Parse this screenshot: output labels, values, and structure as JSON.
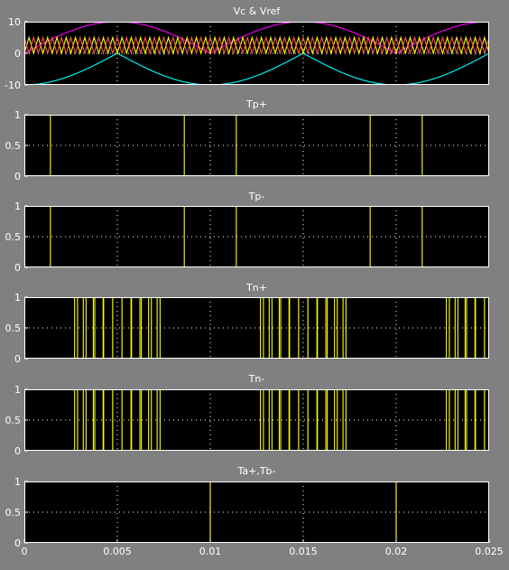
{
  "window": {
    "background": "#808080"
  },
  "colors": {
    "axes_bg": "#000000",
    "axes_border": "#ffffff",
    "grid": "#ffffff",
    "text": "#ffffff",
    "yellow": "#ffff00",
    "magenta": "#ff00ff",
    "cyan": "#00ffff",
    "red": "#ff5050"
  },
  "chart_data": [
    {
      "type": "line",
      "title": "Vc & Vref",
      "xlim": [
        0,
        0.025
      ],
      "ylim": [
        -10,
        10
      ],
      "yticks": [
        -10,
        0,
        10
      ],
      "grid": true,
      "series": [
        {
          "color": "#ff00ff",
          "kind": "abs_sine",
          "amplitude": 10,
          "frequency_hz": 50,
          "phase": 0
        },
        {
          "color": "#00ffff",
          "kind": "abs_sine",
          "amplitude": 10,
          "frequency_hz": 50,
          "phase": 0,
          "offset": -10
        },
        {
          "color": "#ffff00",
          "kind": "triangle",
          "min": 0,
          "max": 5,
          "carrier_hz": 2000
        },
        {
          "color": "#ff5050",
          "kind": "triangle",
          "min": 0,
          "max": 5,
          "carrier_hz": 2000,
          "shifted": true
        }
      ]
    },
    {
      "type": "line",
      "title": "Tp+",
      "xlim": [
        0,
        0.025
      ],
      "ylim": [
        0,
        1
      ],
      "yticks": [
        0,
        0.5,
        1
      ],
      "grid": true,
      "series": [
        {
          "color": "#ffff00",
          "kind": "pwm",
          "active": "positive_half",
          "ref_offset": 5,
          "ref_gain": 1
        }
      ]
    },
    {
      "type": "line",
      "title": "Tp-",
      "xlim": [
        0,
        0.025
      ],
      "ylim": [
        0,
        1
      ],
      "yticks": [
        0,
        0.5,
        1
      ],
      "grid": true,
      "series": [
        {
          "color": "#ffff00",
          "kind": "pwm",
          "active": "positive_half",
          "ref_offset": 5,
          "ref_gain": 1
        }
      ]
    },
    {
      "type": "line",
      "title": "Tn+",
      "xlim": [
        0,
        0.025
      ],
      "ylim": [
        0,
        1
      ],
      "yticks": [
        0,
        0.5,
        1
      ],
      "grid": true,
      "series": [
        {
          "color": "#ffff00",
          "kind": "pwm",
          "active": "negative_half",
          "ref_offset": 0,
          "ref_gain": 1
        }
      ]
    },
    {
      "type": "line",
      "title": "Tn-",
      "xlim": [
        0,
        0.025
      ],
      "ylim": [
        0,
        1
      ],
      "yticks": [
        0,
        0.5,
        1
      ],
      "grid": true,
      "series": [
        {
          "color": "#ffff00",
          "kind": "pwm",
          "active": "negative_half",
          "ref_offset": 0,
          "ref_gain": 1
        }
      ]
    },
    {
      "type": "line",
      "title": "Ta+,Tb-",
      "xlim": [
        0,
        0.025
      ],
      "ylim": [
        0,
        1
      ],
      "yticks": [
        0,
        0.5,
        1
      ],
      "xticks": [
        0,
        0.005,
        0.01,
        0.015,
        0.02,
        0.025
      ],
      "xticklabels": [
        "0",
        "0.005",
        "0.01",
        "0.015",
        "0.02",
        "0.025"
      ],
      "grid": true,
      "series": [
        {
          "color": "#ff00ff",
          "kind": "square",
          "x": [
            0,
            0,
            0.01,
            0.01,
            0.02,
            0.02,
            0.025
          ],
          "y": [
            0,
            1,
            1,
            0,
            0,
            1,
            1
          ]
        },
        {
          "color": "#ffff00",
          "kind": "square",
          "x": [
            0,
            0.01,
            0.01,
            0.02,
            0.02,
            0.025
          ],
          "y": [
            0,
            0,
            1,
            1,
            0,
            0
          ]
        }
      ]
    }
  ]
}
